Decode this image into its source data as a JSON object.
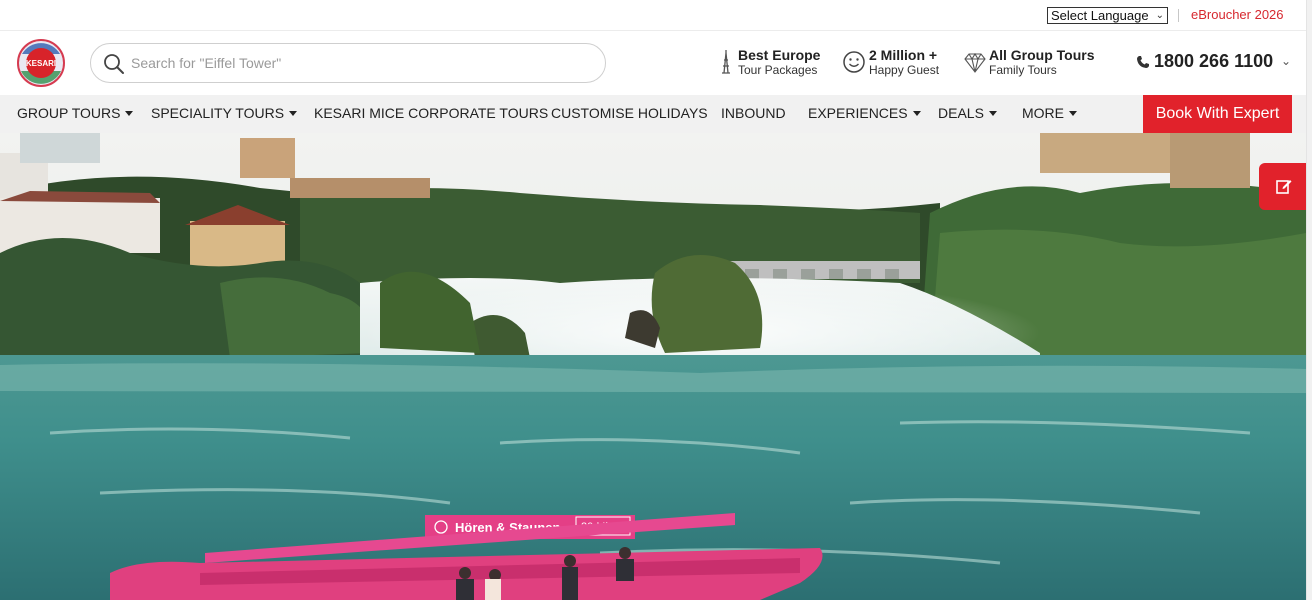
{
  "topbar": {
    "language_select": "Select Language",
    "ebrochure": "eBroucher 2026"
  },
  "header": {
    "logo_text": "KESARI",
    "search_placeholder": "Search for \"Eiffel Tower\"",
    "stats": [
      {
        "title": "Best Europe",
        "subtitle": "Tour Packages",
        "icon": "eiffel-tower-icon"
      },
      {
        "title": "2 Million +",
        "subtitle": "Happy Guest",
        "icon": "smiley-icon"
      },
      {
        "title": "All Group Tours",
        "subtitle": "Family Tours",
        "icon": "diamond-icon"
      }
    ],
    "phone": "1800 266 1100"
  },
  "nav": {
    "items": [
      {
        "label": "GROUP TOURS",
        "dropdown": true
      },
      {
        "label": "SPECIALITY TOURS",
        "dropdown": true
      },
      {
        "label": "KESARI MICE CORPORATE TOURS",
        "dropdown": false
      },
      {
        "label": "CUSTOMISE HOLIDAYS",
        "dropdown": false
      },
      {
        "label": "INBOUND",
        "dropdown": false
      },
      {
        "label": "EXPERIENCES",
        "dropdown": true
      },
      {
        "label": "DEALS",
        "dropdown": true
      },
      {
        "label": "MORE",
        "dropdown": true
      }
    ],
    "book_button": "Book With Expert"
  },
  "hero": {
    "boat_sign": "Hören & Staunen",
    "boat_duration": "30 Min"
  },
  "colors": {
    "brand_red": "#e1222b",
    "nav_bg": "#f1f1f1"
  }
}
